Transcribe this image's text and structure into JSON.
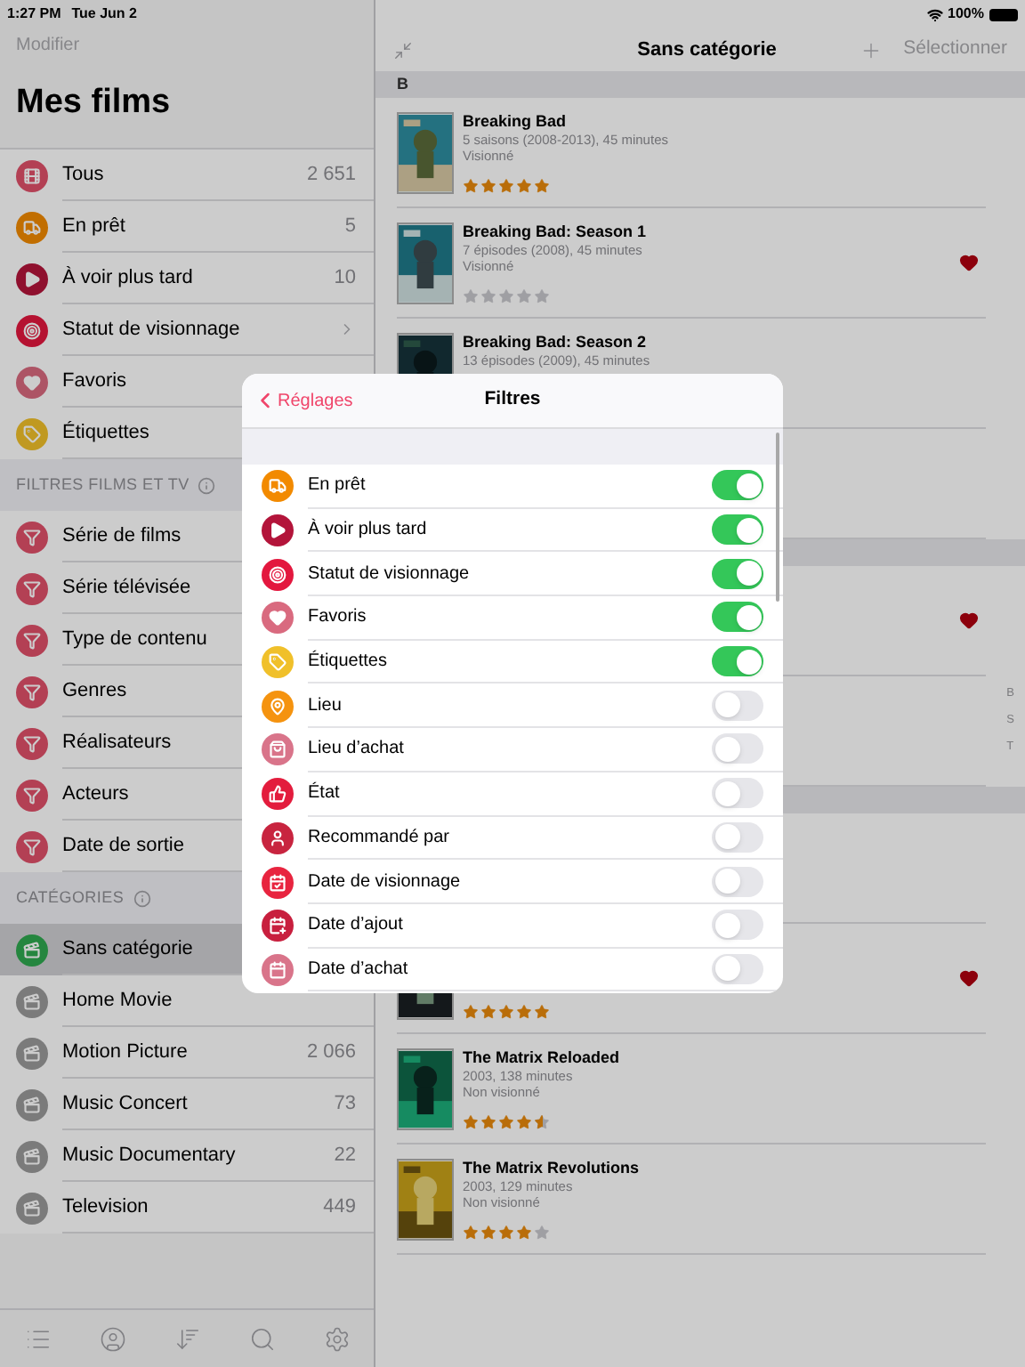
{
  "status_bar": {
    "time": "1:27 PM",
    "date": "Tue Jun 2",
    "battery": "100%"
  },
  "sidebar": {
    "edit": "Modifier",
    "title": "Mes films",
    "main_items": [
      {
        "kind": "all",
        "label": "Tous",
        "count": "2 651"
      },
      {
        "kind": "loan",
        "label": "En prêt",
        "count": "5"
      },
      {
        "kind": "later",
        "label": "À voir plus tard",
        "count": "10"
      },
      {
        "kind": "status",
        "label": "Statut de visionnage",
        "chevron": true
      },
      {
        "kind": "favorite",
        "label": "Favoris"
      },
      {
        "kind": "tag",
        "label": "Étiquettes"
      }
    ],
    "filters_header": "FILTRES FILMS ET TV",
    "filters": [
      {
        "kind": "filter",
        "label": "Série de films"
      },
      {
        "kind": "filter",
        "label": "Série télévisée"
      },
      {
        "kind": "filter",
        "label": "Type de contenu"
      },
      {
        "kind": "filter",
        "label": "Genres"
      },
      {
        "kind": "filter",
        "label": "Réalisateurs"
      },
      {
        "kind": "filter",
        "label": "Acteurs"
      },
      {
        "kind": "filter",
        "label": "Date de sortie"
      }
    ],
    "categories_header": "CATÉGORIES",
    "categories": [
      {
        "kind": "category",
        "label": "Sans catégorie",
        "selected": true
      },
      {
        "kind": "category",
        "label": "Home Movie",
        "selected": false
      },
      {
        "kind": "category",
        "label": "Motion Picture",
        "count": "2 066",
        "selected": false
      },
      {
        "kind": "category",
        "label": "Music Concert",
        "count": "73",
        "selected": false
      },
      {
        "kind": "category",
        "label": "Music Documentary",
        "count": "22",
        "selected": false
      },
      {
        "kind": "category",
        "label": "Television",
        "count": "449",
        "selected": false
      }
    ]
  },
  "content": {
    "title": "Sans catégorie",
    "select": "Sélectionner",
    "index": [
      "B",
      "S",
      "T"
    ],
    "rows": [
      {
        "kind": "section",
        "letter": "B"
      },
      {
        "kind": "movie",
        "title": "Breaking Bad",
        "subtitle": "5 saisons (2008-2013), 45 minutes",
        "status": "Visionné",
        "stars": 5,
        "favorite": false
      },
      {
        "kind": "movie",
        "title": "Breaking Bad: Season 1",
        "subtitle": "7 épisodes (2008), 45 minutes",
        "status": "Visionné",
        "stars": 0,
        "favorite": true
      },
      {
        "kind": "movie",
        "title": "Breaking Bad: Season 2",
        "subtitle": "13 épisodes (2009), 45 minutes",
        "favorite": false
      },
      {
        "kind": "blank",
        "favorite": false
      },
      {
        "kind": "section"
      },
      {
        "kind": "blank",
        "favorite": true
      },
      {
        "kind": "blank",
        "favorite": false
      },
      {
        "kind": "section"
      },
      {
        "kind": "blank",
        "favorite": false
      },
      {
        "kind": "movie",
        "stars": 5,
        "favorite": true
      },
      {
        "kind": "movie",
        "title": "The Matrix Reloaded",
        "subtitle": "2003, 138 minutes",
        "status": "Non visionné",
        "stars": 4.5,
        "favorite": false
      },
      {
        "kind": "movie",
        "title": "The Matrix Revolutions",
        "subtitle": "2003, 129 minutes",
        "status": "Non visionné",
        "stars": 4,
        "favorite": false
      }
    ]
  },
  "popover": {
    "back": "Réglages",
    "title": "Filtres",
    "items": [
      {
        "kind": "loan",
        "label": "En prêt",
        "on": true
      },
      {
        "kind": "later",
        "label": "À voir plus tard",
        "on": true
      },
      {
        "kind": "status",
        "label": "Statut de visionnage",
        "on": true
      },
      {
        "kind": "favorite",
        "label": "Favoris",
        "on": true
      },
      {
        "kind": "tag",
        "label": "Étiquettes",
        "on": true
      },
      {
        "kind": "location",
        "label": "Lieu",
        "on": false
      },
      {
        "kind": "store",
        "label": "Lieu d’achat",
        "on": false
      },
      {
        "kind": "condition",
        "label": "État",
        "on": false
      },
      {
        "kind": "recommended",
        "label": "Recommandé par",
        "on": false
      },
      {
        "kind": "watched_date",
        "label": "Date de visionnage",
        "on": false
      },
      {
        "kind": "added_date",
        "label": "Date d’ajout",
        "on": false
      },
      {
        "kind": "purchase_date",
        "label": "Date d’achat",
        "on": false
      }
    ]
  }
}
